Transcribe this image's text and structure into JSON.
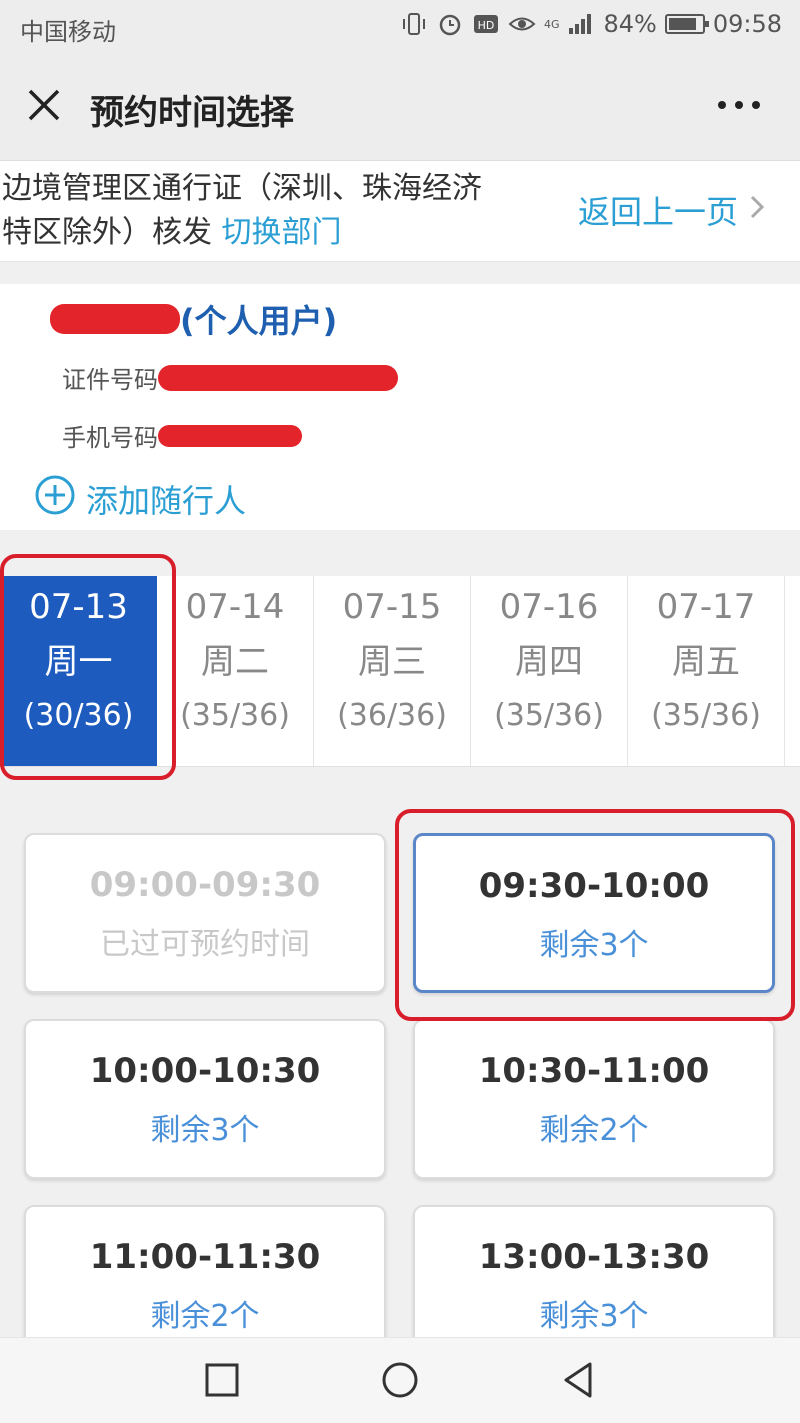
{
  "status_bar": {
    "carrier": "中国移动",
    "network": "4G",
    "battery": "84%",
    "battery_level": 0.84,
    "time": "09:58"
  },
  "titlebar": {
    "title": "预约时间选择"
  },
  "service": {
    "name": "边境管理区通行证（深圳、珠海经济特区除外）核发",
    "switch_label": "切换部门",
    "back_label": "返回上一页"
  },
  "user": {
    "user_type": "(个人用户)",
    "id_label": "证件号码",
    "phone_label": "手机号码",
    "add_companion": "添加随行人"
  },
  "dates": [
    {
      "date": "07-13",
      "weekday": "周一",
      "count": "(30/36)",
      "active": true
    },
    {
      "date": "07-14",
      "weekday": "周二",
      "count": "(35/36)",
      "active": false
    },
    {
      "date": "07-15",
      "weekday": "周三",
      "count": "(36/36)",
      "active": false
    },
    {
      "date": "07-16",
      "weekday": "周四",
      "count": "(35/36)",
      "active": false
    },
    {
      "date": "07-17",
      "weekday": "周五",
      "count": "(35/36)",
      "active": false
    }
  ],
  "slots": [
    {
      "time": "09:00-09:30",
      "remaining": "已过可预约时间",
      "state": "disabled"
    },
    {
      "time": "09:30-10:00",
      "remaining": "剩余3个",
      "state": "selected"
    },
    {
      "time": "10:00-10:30",
      "remaining": "剩余3个",
      "state": "available"
    },
    {
      "time": "10:30-11:00",
      "remaining": "剩余2个",
      "state": "available"
    },
    {
      "time": "11:00-11:30",
      "remaining": "剩余2个",
      "state": "available"
    },
    {
      "time": "13:00-13:30",
      "remaining": "剩余3个",
      "state": "available"
    }
  ],
  "colors": {
    "accent_link": "#2b9fd4",
    "active_date": "#1d5bbf",
    "highlight_red": "#d81e2a",
    "remaining_text": "#4a90d9"
  }
}
